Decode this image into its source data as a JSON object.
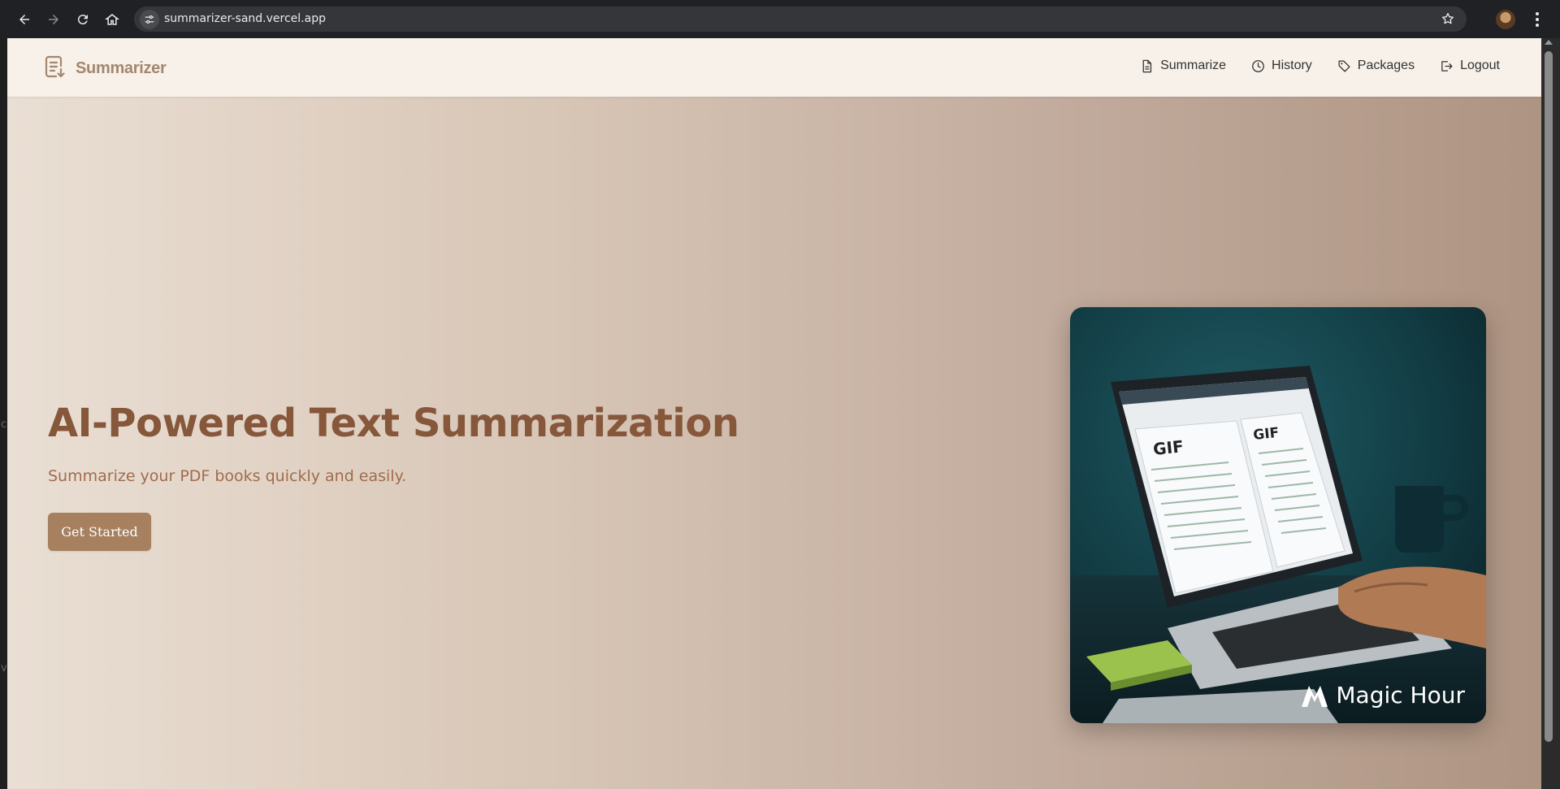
{
  "browser": {
    "url": "summarizer-sand.vercel.app",
    "icons": [
      "back-icon",
      "forward-icon",
      "reload-icon",
      "home-icon",
      "site-info-icon",
      "bookmark-star-icon",
      "profile-avatar",
      "menu-kebab-icon"
    ]
  },
  "left_strip": {
    "char_1": "c",
    "char_2": "v"
  },
  "navbar": {
    "brand": "Summarizer",
    "links": [
      {
        "label": "Summarize",
        "icon": "document-icon"
      },
      {
        "label": "History",
        "icon": "clock-icon"
      },
      {
        "label": "Packages",
        "icon": "tag-icon"
      },
      {
        "label": "Logout",
        "icon": "logout-icon"
      }
    ]
  },
  "hero": {
    "title": "AI-Powered Text Summarization",
    "subtitle": "Summarize your PDF books quickly and easily.",
    "cta_label": "Get Started"
  },
  "illustration": {
    "screen_labels": [
      "GIF",
      "GIF"
    ],
    "watermark": "Magic Hour"
  },
  "colors": {
    "brand": "#a3876e",
    "title": "#86573b",
    "subtitle": "#a06c4c",
    "button": "#a6805f",
    "navbar_bg": "#f7f1ea"
  }
}
